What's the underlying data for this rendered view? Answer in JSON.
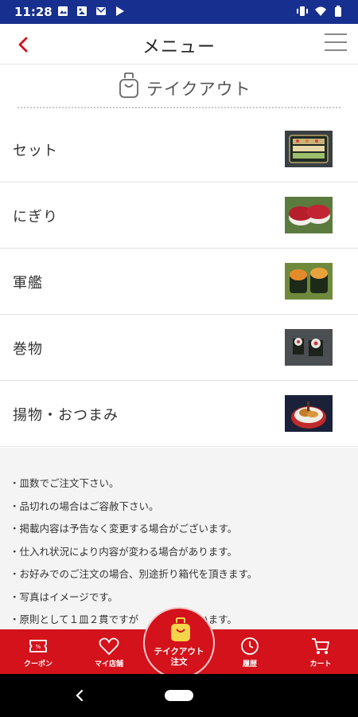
{
  "status_bar": {
    "time": "11:28"
  },
  "header": {
    "title": "メニュー"
  },
  "section": {
    "label": "テイクアウト"
  },
  "categories": [
    {
      "label": "セット",
      "image": "sushi-set-tray"
    },
    {
      "label": "にぎり",
      "image": "tuna-nigiri"
    },
    {
      "label": "軍艦",
      "image": "uni-gunkan"
    },
    {
      "label": "巻物",
      "image": "maki-roll"
    },
    {
      "label": "揚物・おつまみ",
      "image": "fried-bowl"
    }
  ],
  "notes": [
    "・皿数でご注文下さい。",
    "・品切れの場合はご容赦下さい。",
    "・掲載内容は予告なく変更する場合がございます。",
    "・仕入れ状況により内容が変わる場合があります。",
    "・お好みでのご注文の場合、別途折り箱代を頂きます。",
    "・写真はイメージです。",
    "・原則として１皿２貫ですが　　　もございます。"
  ],
  "bottom_nav": {
    "coupon": "クーポン",
    "my_store": "マイ店舗",
    "takeout_line1": "テイクアウト",
    "takeout_line2": "注文",
    "history": "履歴",
    "cart": "カート"
  },
  "colors": {
    "accent": "#d4121b",
    "status_bar": "#17308f"
  }
}
